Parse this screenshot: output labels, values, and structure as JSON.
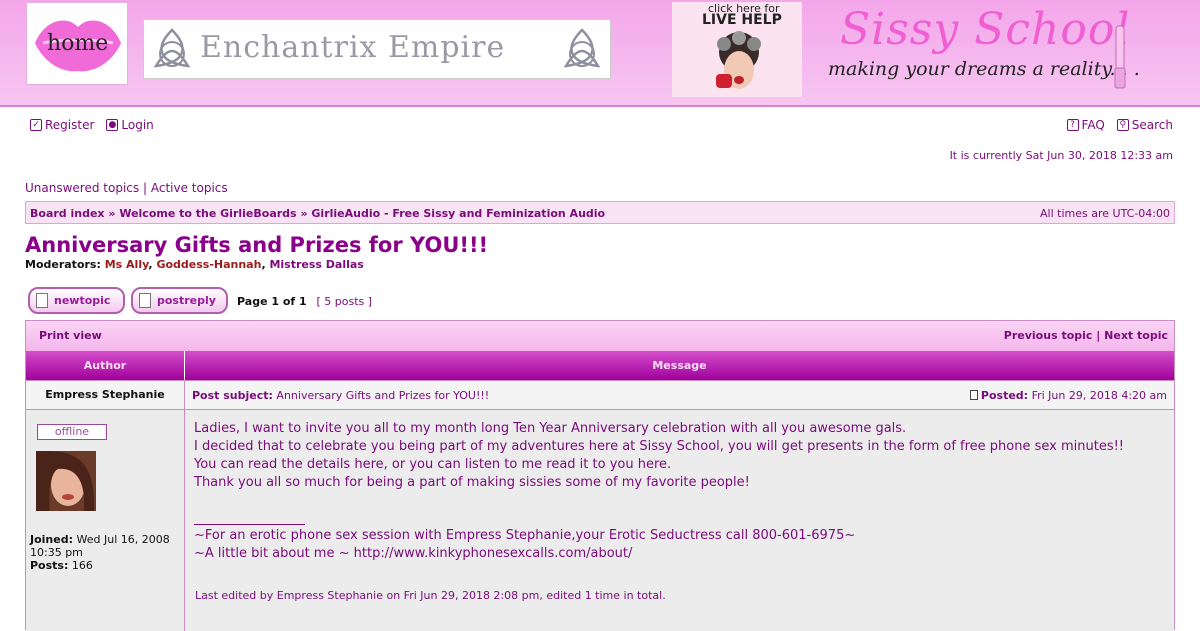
{
  "header": {
    "home_label": "home",
    "empire_title": "Enchantrix Empire",
    "live_help_small": "click here for",
    "live_help_big": "LIVE HELP",
    "site_title": "Sissy School",
    "site_tagline": "making your dreams a reality. . .",
    "accent": "#ef5fd2"
  },
  "topnav": {
    "register_label": "Register",
    "login_label": "Login",
    "faq_label": "FAQ",
    "search_label": "Search"
  },
  "current_time": "It is currently Sat Jun 30, 2018 12:33 am",
  "quicklinks": {
    "unanswered": "Unanswered topics",
    "separator": "|",
    "active": "Active topics"
  },
  "breadcrumb": {
    "items": [
      "Board index",
      "Welcome to the GirlieBoards",
      "GirlieAudio - Free Sissy and Feminization Audio"
    ],
    "separator": "»",
    "timezone": "All times are UTC-04:00"
  },
  "topic": {
    "title": "Anniversary Gifts and Prizes for YOU!!!",
    "moderators_label": "Moderators:",
    "moderators": [
      "Ms Ally",
      "Goddess-Hannah",
      "Mistress Dallas"
    ]
  },
  "buttons": {
    "new_topic": "newtopic",
    "post_reply": "postreply"
  },
  "pagination": {
    "page_text": "Page 1 of 1",
    "posts_text": "[ 5 posts ]"
  },
  "toolbar": {
    "print_view": "Print view",
    "previous_topic": "Previous topic",
    "separator": "|",
    "next_topic": "Next topic"
  },
  "table_header": {
    "author": "Author",
    "message": "Message"
  },
  "post": {
    "author": "Empress Stephanie",
    "subject_label": "Post subject:",
    "subject": "Anniversary Gifts and Prizes for YOU!!!",
    "posted_label": "Posted:",
    "posted": "Fri Jun 29, 2018 4:20 am",
    "status": "offline",
    "joined_label": "Joined:",
    "joined": "Wed Jul 16, 2008 10:35 pm",
    "posts_label": "Posts:",
    "posts_count": "166",
    "body_lines": [
      "Ladies, I want to invite you all to my month long Ten Year Anniversary celebration with all you awesome gals.",
      "I decided that to celebrate you being part of my adventures here at Sissy School, you will get presents in the form of free phone sex minutes!!",
      "You can read the details here, or you can listen to me read it to you here.",
      "Thank you all so much for being a part of making sissies some of my favorite people!"
    ],
    "signature_lines": [
      "~For an erotic phone sex session with Empress Stephanie,your Erotic Seductress call 800-601-6975~",
      "~A little bit about me ~ http://www.kinkyphonesexcalls.com/about/"
    ],
    "edited_note": "Last edited by Empress Stephanie on Fri Jun 29, 2018 2:08 pm, edited 1 time in total."
  }
}
